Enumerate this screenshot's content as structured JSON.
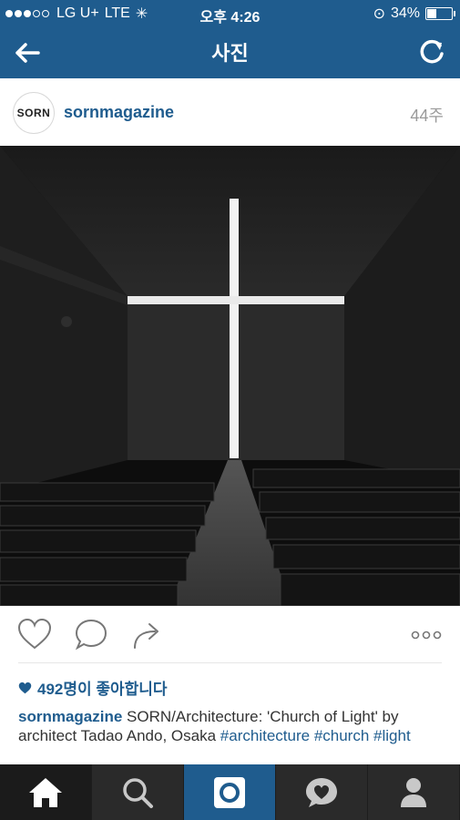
{
  "status_bar": {
    "carrier": "LG U+",
    "network": "LTE",
    "time": "오후 4:26",
    "battery": "34%"
  },
  "nav": {
    "title": "사진"
  },
  "post": {
    "avatar_text": "SORN",
    "username": "sornmagazine",
    "age": "44주",
    "likes": "492명이 좋아합니다",
    "caption": {
      "username": "sornmagazine",
      "text": "SORN/Architecture: 'Church of Light' by architect Tadao Ando, Osaka",
      "hashtags": [
        "#architecture",
        "#church",
        "#light"
      ]
    }
  },
  "tabs": [
    "home-icon",
    "search-icon",
    "camera-icon",
    "activity-icon",
    "profile-icon"
  ],
  "colors": {
    "brand": "#1f5c8e",
    "tabbar": "#2a2a2a"
  }
}
